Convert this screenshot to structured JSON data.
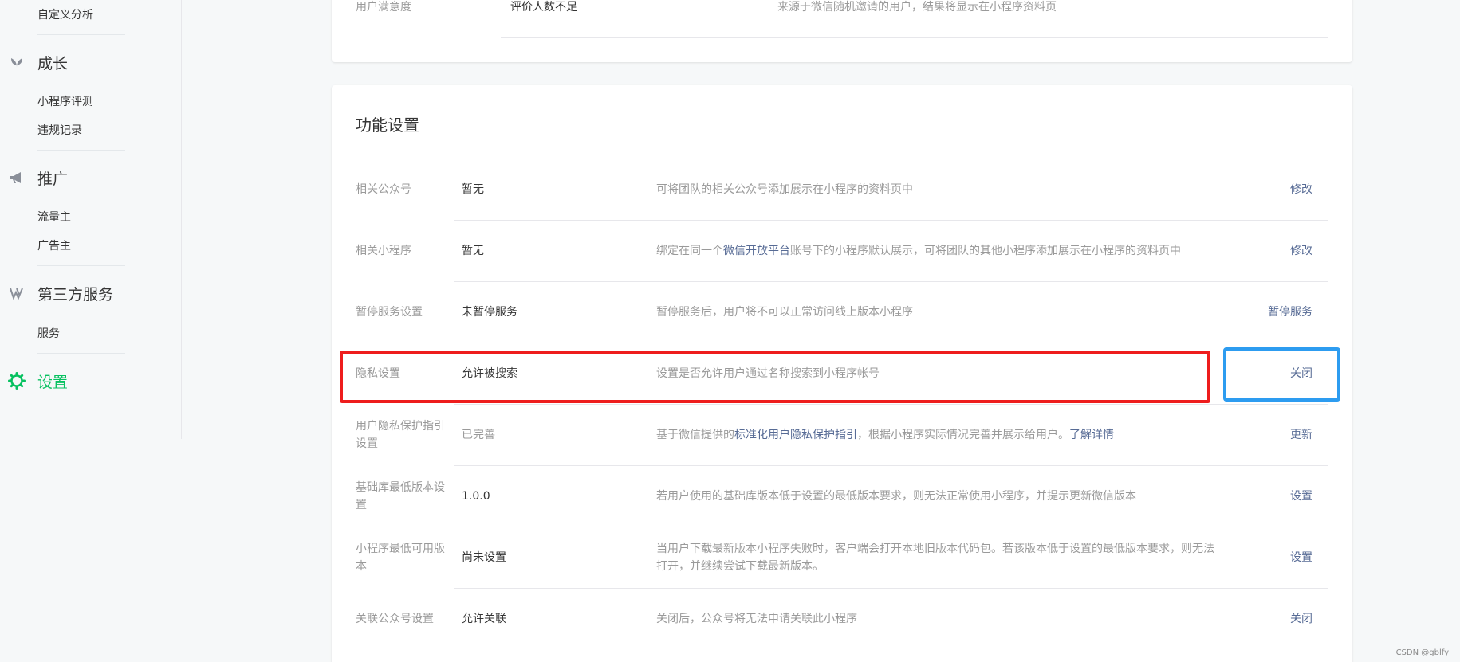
{
  "sidebar": {
    "custom_analysis": "自定义分析",
    "growth": {
      "title": "成长",
      "items": [
        "小程序评测",
        "违规记录"
      ]
    },
    "promote": {
      "title": "推广",
      "items": [
        "流量主",
        "广告主"
      ]
    },
    "third_party": {
      "title": "第三方服务",
      "items": [
        "服务"
      ]
    },
    "settings": {
      "title": "设置"
    },
    "accent_color": "#07c160"
  },
  "top_panel": {
    "label": "用户满意度",
    "value": "评价人数不足",
    "desc": "来源于微信随机邀请的用户，结果将显示在小程序资料页"
  },
  "feature_settings": {
    "title": "功能设置",
    "rows": [
      {
        "label": "相关公众号",
        "value": "暂无",
        "desc": "可将团队的相关公众号添加展示在小程序的资料页中",
        "action": "修改"
      },
      {
        "label": "相关小程序",
        "value": "暂无",
        "desc_pre": "绑定在同一个",
        "desc_link": "微信开放平台",
        "desc_post": "账号下的小程序默认展示，可将团队的其他小程序添加展示在小程序的资料页中",
        "action": "修改"
      },
      {
        "label": "暂停服务设置",
        "value": "未暂停服务",
        "desc": "暂停服务后，用户将不可以正常访问线上版本小程序",
        "action": "暂停服务"
      },
      {
        "label": "隐私设置",
        "value": "允许被搜索",
        "desc": "设置是否允许用户通过名称搜索到小程序帐号",
        "action": "关闭"
      },
      {
        "label_line1": "用户隐私保护指引",
        "label_line2": "设置",
        "value": "已完善",
        "desc_pre": "基于微信提供的",
        "desc_link": "标准化用户隐私保护指引",
        "desc_mid": "，根据小程序实际情况完善并展示给用户。",
        "desc_link2": "了解详情",
        "action": "更新"
      },
      {
        "label_line1": "基础库最低版本设",
        "label_line2": "置",
        "value": "1.0.0",
        "desc": "若用户使用的基础库版本低于设置的最低版本要求，则无法正常使用小程序，并提示更新微信版本",
        "action": "设置"
      },
      {
        "label_line1": "小程序最低可用版",
        "label_line2": "本",
        "value": "尚未设置",
        "desc_line1": "当用户下载最新版本小程序失败时，客户端会打开本地旧版本代码包。若该版本低于设置的最低版本要求，则无法",
        "desc_line2": "打开，并继续尝试下载最新版本。",
        "action": "设置"
      },
      {
        "label": "关联公众号设置",
        "value": "允许关联",
        "desc": "关闭后，公众号将无法申请关联此小程序",
        "action": "关闭"
      }
    ]
  },
  "highlight_colors": {
    "red": "#ee1d1d",
    "blue": "#2d9cf0"
  },
  "link_color": "#576b95",
  "watermark": "CSDN @gblfy"
}
